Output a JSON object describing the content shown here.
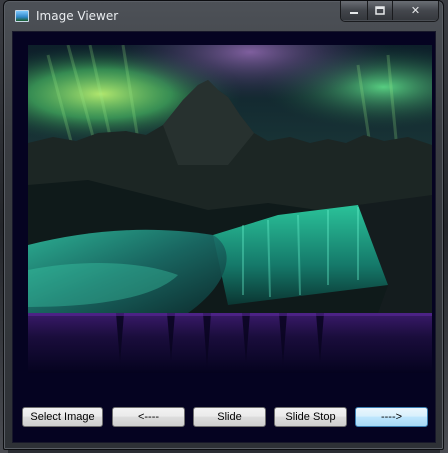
{
  "window": {
    "title": "Image Viewer",
    "icon": "image-icon",
    "controls": {
      "minimize_icon": "minimize-icon",
      "maximize_icon": "maximize-icon",
      "close_label": "✕"
    }
  },
  "viewer": {
    "background_color": "#050321",
    "image_subject": "aurora over mountain and waterfall"
  },
  "buttons": {
    "select_image": "Select Image",
    "previous": "<----",
    "slide": "Slide",
    "slide_stop": "Slide Stop",
    "next": "---->"
  },
  "colors": {
    "focus_accent": "#3c7fb1",
    "aurora_green": "#2fdc9a"
  }
}
